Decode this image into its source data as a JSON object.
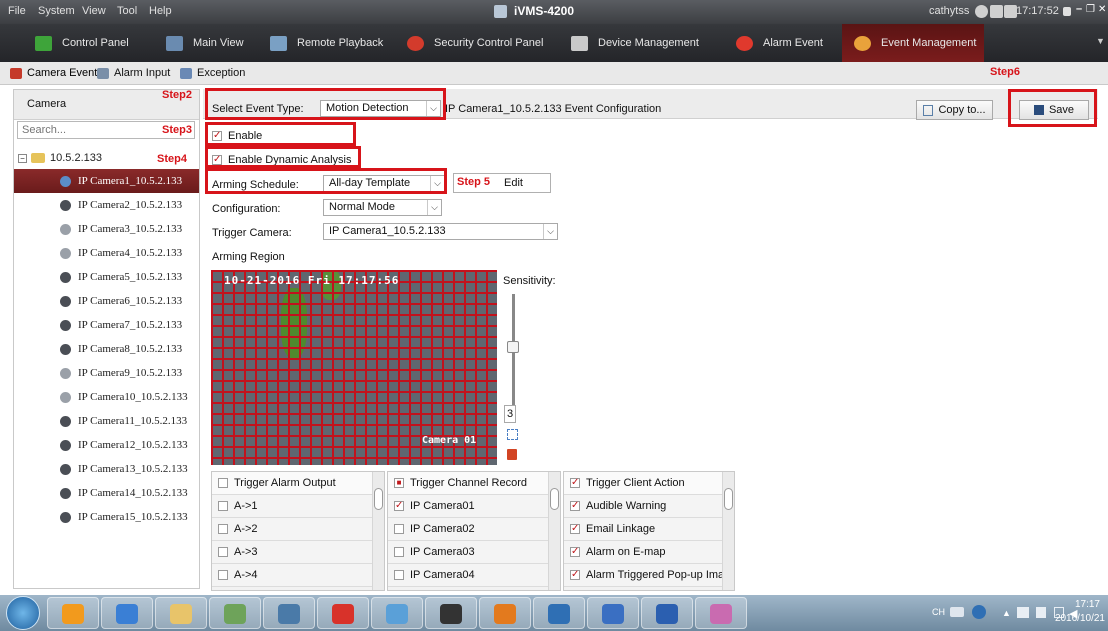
{
  "titlebar": {
    "menu": [
      "File",
      "System",
      "View",
      "Tool",
      "Help"
    ],
    "title": "iVMS-4200",
    "user": "cathytss",
    "time": "17:17:52"
  },
  "tabs": [
    {
      "label": "Control Panel",
      "color": "#3ea43a"
    },
    {
      "label": "Main View",
      "color": "#6a8bb0"
    },
    {
      "label": "Remote Playback",
      "color": "#7aa0c4"
    },
    {
      "label": "Security Control Panel",
      "color": "#d33b2c"
    },
    {
      "label": "Device Management",
      "color": "#c9c9c9"
    },
    {
      "label": "Alarm Event",
      "color": "#e0392d"
    },
    {
      "label": "Event Management",
      "color": "#e9a23b"
    }
  ],
  "subtabs": [
    "Camera Event",
    "Alarm Input",
    "Exception"
  ],
  "left": {
    "header": "Camera",
    "search_placeholder": "Search...",
    "root": "10.5.2.133",
    "cameras": [
      "IP Camera1_10.5.2.133",
      "IP Camera2_10.5.2.133",
      "IP Camera3_10.5.2.133",
      "IP Camera4_10.5.2.133",
      "IP Camera5_10.5.2.133",
      "IP Camera6_10.5.2.133",
      "IP Camera7_10.5.2.133",
      "IP Camera8_10.5.2.133",
      "IP Camera9_10.5.2.133",
      "IP Camera10_10.5.2.133",
      "IP Camera11_10.5.2.133",
      "IP Camera12_10.5.2.133",
      "IP Camera13_10.5.2.133",
      "IP Camera14_10.5.2.133",
      "IP Camera15_10.5.2.133"
    ],
    "offline": [
      2,
      3,
      8,
      9
    ]
  },
  "steps": {
    "s2": "Step2",
    "s3": "Step3",
    "s4": "Step4",
    "s5": "Step 5",
    "s6": "Step6"
  },
  "config": {
    "event_type_label": "Select Event Type:",
    "event_type_value": "Motion Detection",
    "config_title": "IP Camera1_10.5.2.133 Event Configuration",
    "copy_label": "Copy to...",
    "save_label": "Save",
    "enable_label": "Enable",
    "dynamic_label": "Enable Dynamic Analysis",
    "arming_label": "Arming Schedule:",
    "arming_value": "All-day Template",
    "edit_label": "Edit",
    "configuration_label": "Configuration:",
    "configuration_value": "Normal Mode",
    "trigger_camera_label": "Trigger Camera:",
    "trigger_camera_value": "IP Camera1_10.5.2.133",
    "arming_region_label": "Arming Region",
    "sensitivity_label": "Sensitivity:",
    "sensitivity_value": "3",
    "timestamp": "10-21-2016 Fri 17:17:56",
    "camera_name": "Camera 01"
  },
  "lists": {
    "alarm_output": {
      "header": "Trigger Alarm Output",
      "items": [
        "A->1",
        "A->2",
        "A->3",
        "A->4"
      ]
    },
    "channel_record": {
      "header": "Trigger Channel Record",
      "items": [
        "IP Camera01",
        "IP Camera02",
        "IP Camera03",
        "IP Camera04"
      ],
      "checked": [
        true,
        false,
        false,
        false
      ]
    },
    "client_action": {
      "header": "Trigger Client Action",
      "items": [
        "Audible Warning",
        "Email Linkage",
        "Alarm on E-map",
        "Alarm Triggered Pop-up Ima..."
      ]
    }
  },
  "taskbar": {
    "lang": "CH",
    "time": "17:17",
    "date": "2016/10/21",
    "apps": [
      "#f29a1d",
      "#3a7fd5",
      "#e8c46a",
      "#6ea35a",
      "#4a7aa8",
      "#d8322a",
      "#5aa0d8",
      "#333333",
      "#e37a1e",
      "#2f6fb4",
      "#3a6fc2",
      "#2b5fb0",
      "#c96bb0"
    ]
  }
}
